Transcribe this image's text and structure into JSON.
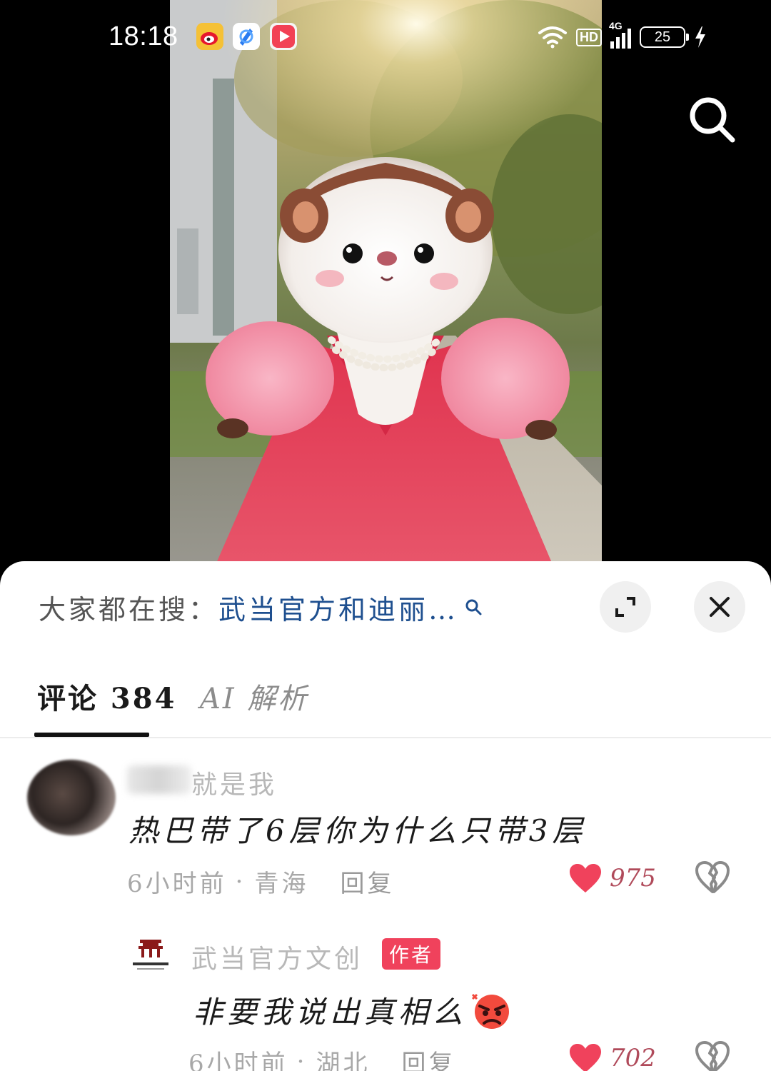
{
  "status_bar": {
    "time": "18:18",
    "network_badge": "HD",
    "signal_label": "4G",
    "battery_level": "25",
    "notification_icons": [
      "weibo-icon",
      "browser-icon",
      "video-app-icon"
    ]
  },
  "video": {
    "media_icon": "hamster-in-red-gown-image"
  },
  "sheet": {
    "suggest_prefix": "大家都在搜：",
    "suggest_query": "武当官方和迪丽…",
    "tabs": [
      {
        "label": "评论 384",
        "active": true
      },
      {
        "label": "AI 解析",
        "active": false
      }
    ]
  },
  "comments": [
    {
      "username_visible": "就是我",
      "text": "热巴带了6层你为什么只带3层",
      "time": "6小时前",
      "location": "青海",
      "reply_label": "回复",
      "likes": "975"
    },
    {
      "username": "武当官方文创",
      "badge": "作者",
      "text": "非要我说出真相么",
      "emoji": "angry-face-icon",
      "time": "6小时前",
      "location": "湖北",
      "reply_label": "回复",
      "likes": "702"
    }
  ],
  "colors": {
    "accent_like": "#f0425c",
    "search_link": "#1e4f8f",
    "author_badge": "#f0425c"
  }
}
